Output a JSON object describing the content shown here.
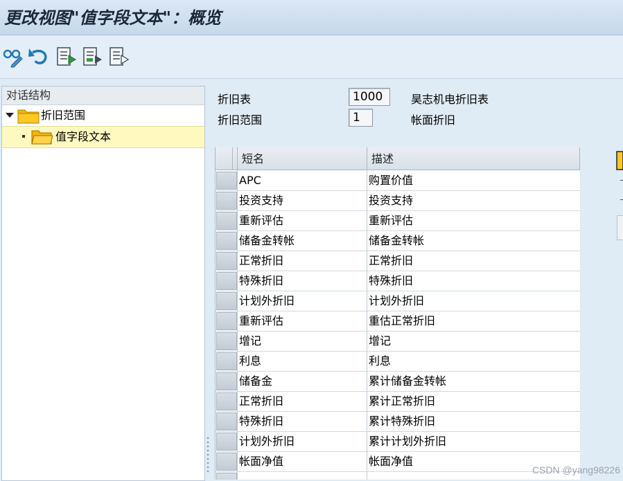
{
  "window": {
    "title": "更改视图\"值字段文本\"：概览"
  },
  "toolbar": {
    "buttons": [
      {
        "icon": "change-display-glasses-pencil-icon"
      },
      {
        "icon": "undo-icon"
      },
      {
        "icon": "document-list-icon"
      },
      {
        "icon": "document-select-icon"
      },
      {
        "icon": "document-deselect-icon"
      }
    ]
  },
  "dialog_structure": {
    "header": "对话结构",
    "items": [
      {
        "label": "折旧范围",
        "level": 0,
        "expanded": true,
        "selected": false
      },
      {
        "label": "值字段文本",
        "level": 1,
        "expanded": false,
        "selected": true
      }
    ]
  },
  "fields": [
    {
      "label": "折旧表",
      "value": "1000",
      "text": "昊志机电折旧表"
    },
    {
      "label": "折旧范围",
      "value": "1",
      "text": "帐面折旧"
    }
  ],
  "table": {
    "columns": [
      "短名",
      "描述"
    ],
    "rows": [
      [
        "APC",
        "购置价值"
      ],
      [
        "投资支持",
        "投资支持"
      ],
      [
        "重新评估",
        "重新评估"
      ],
      [
        "储备金转帐",
        "储备金转帐"
      ],
      [
        "正常折旧",
        "正常折旧"
      ],
      [
        "特殊折旧",
        "特殊折旧"
      ],
      [
        "计划外折旧",
        "计划外折旧"
      ],
      [
        "重新评估",
        "重估正常折旧"
      ],
      [
        "增记",
        "增记"
      ],
      [
        "利息",
        "利息"
      ],
      [
        "储备金",
        "累计储备金转帐"
      ],
      [
        "正常折旧",
        "累计正常折旧"
      ],
      [
        "特殊折旧",
        "累计特殊折旧"
      ],
      [
        "计划外折旧",
        "累计计划外折旧"
      ],
      [
        "帐面净值",
        "帐面净值"
      ],
      [
        "",
        ""
      ]
    ]
  },
  "watermark": "CSDN @yang98226",
  "colors": {
    "title_bar": "#c6d8ea",
    "selected_tree_row": "#fff9c0",
    "folder_icon": "#f2b705",
    "toolbar_icon": "#1f78b4"
  }
}
